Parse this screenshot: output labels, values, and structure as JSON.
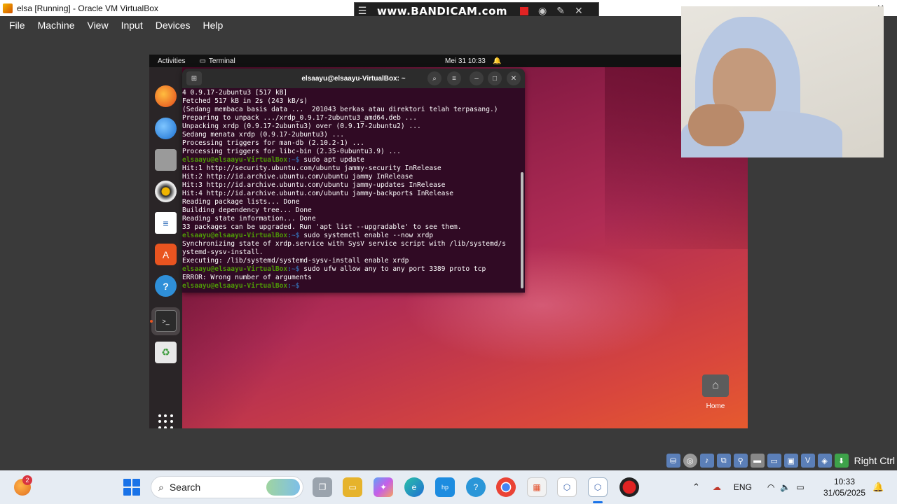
{
  "host_window": {
    "title": "elsa [Running] - Oracle VM VirtualBox",
    "minimize_glyph": "−",
    "close_glyph": "✕"
  },
  "bandicam": {
    "logo": "www.BANDICAM.com"
  },
  "vbox_menu": {
    "items": [
      "File",
      "Machine",
      "View",
      "Input",
      "Devices",
      "Help"
    ]
  },
  "guest": {
    "topbar": {
      "activities": "Activities",
      "app_name": "Terminal",
      "clock": "Mei 31  10:33"
    },
    "dock_icons": [
      "firefox-icon",
      "thunderbird-icon",
      "files-icon",
      "rhythmbox-icon",
      "libreoffice-writer-icon",
      "app-center-icon",
      "help-icon",
      "terminal-icon",
      "trash-icon"
    ],
    "terminal": {
      "title": "elsaayu@elsaayu-VirtualBox: ~",
      "prompt_user": "elsaayu@elsaayu-VirtualBox",
      "prompt_path": ":~$ ",
      "lines": [
        {
          "type": "out",
          "text": "4 0.9.17-2ubuntu3 [517 kB]"
        },
        {
          "type": "out",
          "text": "Fetched 517 kB in 2s (243 kB/s)"
        },
        {
          "type": "out",
          "text": "(Sedang membaca basis data ...  201043 berkas atau direktori telah terpasang.)"
        },
        {
          "type": "out",
          "text": "Preparing to unpack .../xrdp_0.9.17-2ubuntu3_amd64.deb ..."
        },
        {
          "type": "out",
          "text": "Unpacking xrdp (0.9.17-2ubuntu3) over (0.9.17-2ubuntu2) ..."
        },
        {
          "type": "out",
          "text": "Sedang menata xrdp (0.9.17-2ubuntu3) ..."
        },
        {
          "type": "out",
          "text": "Processing triggers for man-db (2.10.2-1) ..."
        },
        {
          "type": "out",
          "text": "Processing triggers for libc-bin (2.35-0ubuntu3.9) ..."
        },
        {
          "type": "cmd",
          "text": "sudo apt update"
        },
        {
          "type": "out",
          "text": "Hit:1 http://security.ubuntu.com/ubuntu jammy-security InRelease"
        },
        {
          "type": "out",
          "text": "Hit:2 http://id.archive.ubuntu.com/ubuntu jammy InRelease"
        },
        {
          "type": "out",
          "text": "Hit:3 http://id.archive.ubuntu.com/ubuntu jammy-updates InRelease"
        },
        {
          "type": "out",
          "text": "Hit:4 http://id.archive.ubuntu.com/ubuntu jammy-backports InRelease"
        },
        {
          "type": "out",
          "text": "Reading package lists... Done"
        },
        {
          "type": "out",
          "text": "Building dependency tree... Done"
        },
        {
          "type": "out",
          "text": "Reading state information... Done"
        },
        {
          "type": "out",
          "text": "33 packages can be upgraded. Run 'apt list --upgradable' to see them."
        },
        {
          "type": "cmd",
          "text": "sudo systemctl enable --now xrdp"
        },
        {
          "type": "out",
          "text": "Synchronizing state of xrdp.service with SysV service script with /lib/systemd/s"
        },
        {
          "type": "out",
          "text": "ystemd-sysv-install."
        },
        {
          "type": "out",
          "text": "Executing: /lib/systemd/systemd-sysv-install enable xrdp"
        },
        {
          "type": "cmd",
          "text": "sudo ufw allow any to any port 3389 proto tcp"
        },
        {
          "type": "out",
          "text": "ERROR: Wrong number of arguments"
        },
        {
          "type": "cmd",
          "text": ""
        }
      ]
    },
    "desktop": {
      "home_label": "Home"
    }
  },
  "vbox_status": {
    "host_key": "Right Ctrl"
  },
  "taskbar": {
    "weather_badge": "2",
    "search_label": "Search",
    "language": "ENG",
    "time": "10:33",
    "date": "31/05/2025"
  },
  "colors": {
    "terminal_bg": "#300a24",
    "prompt_user": "#4e9a06",
    "prompt_path": "#3465a4",
    "ubuntu_orange": "#e95420"
  }
}
